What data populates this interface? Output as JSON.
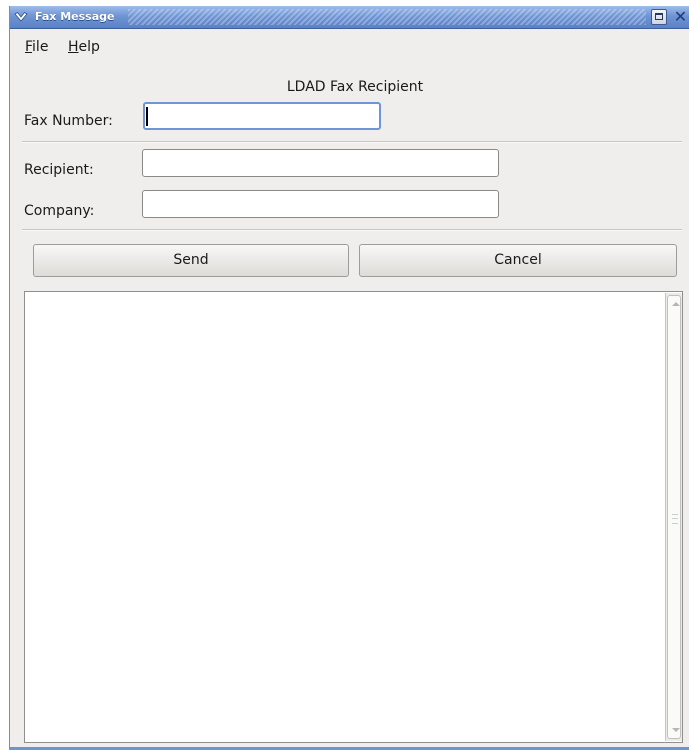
{
  "window": {
    "title": "Fax Message",
    "close_glyph": "✕",
    "icons": [
      "window-menu-icon",
      "maximize-icon",
      "close-icon"
    ]
  },
  "menubar": {
    "file": {
      "mnemonic": "F",
      "rest": "ile"
    },
    "help": {
      "mnemonic": "H",
      "rest": "elp"
    }
  },
  "form": {
    "title": "LDAD Fax Recipient",
    "fax_number_label": "Fax Number:",
    "fax_number_value": "",
    "recipient_label": "Recipient:",
    "recipient_value": "",
    "company_label": "Company:",
    "company_value": ""
  },
  "buttons": {
    "send": "Send",
    "cancel": "Cancel"
  },
  "message": {
    "body": ""
  },
  "colors": {
    "titlebar": "#6e94d4",
    "focus_border": "#6f95d6",
    "window_bg": "#efeeec"
  }
}
